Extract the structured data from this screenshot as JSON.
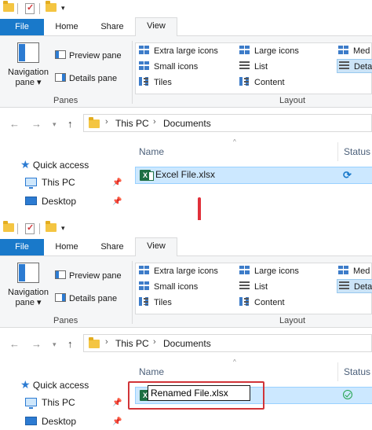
{
  "tabs": {
    "file": "File",
    "home": "Home",
    "share": "Share",
    "view": "View"
  },
  "ribbon": {
    "navigation_pane": "Navigation pane",
    "preview_pane": "Preview pane",
    "details_pane": "Details pane",
    "panes_label": "Panes",
    "layout_label": "Layout",
    "layout_items": {
      "extra_large_icons": "Extra large icons",
      "large_icons": "Large icons",
      "medium_partial": "Med",
      "small_icons": "Small icons",
      "list": "List",
      "details_partial": "Deta",
      "tiles": "Tiles",
      "content": "Content"
    }
  },
  "address": {
    "this_pc": "This PC",
    "documents": "Documents"
  },
  "columns": {
    "name": "Name",
    "status": "Status"
  },
  "nav_items": {
    "quick_access": "Quick access",
    "this_pc": "This PC",
    "desktop": "Desktop"
  },
  "before": {
    "file_name": "Excel File.xlsx",
    "status_icon": "sync-icon"
  },
  "after": {
    "file_name": "Renamed File.xlsx",
    "status_icon": "available-check-icon"
  },
  "colors": {
    "file_tab": "#1979ca",
    "highlight": "#d13438",
    "arrow": "#e0303a",
    "selection": "#cce8ff"
  }
}
